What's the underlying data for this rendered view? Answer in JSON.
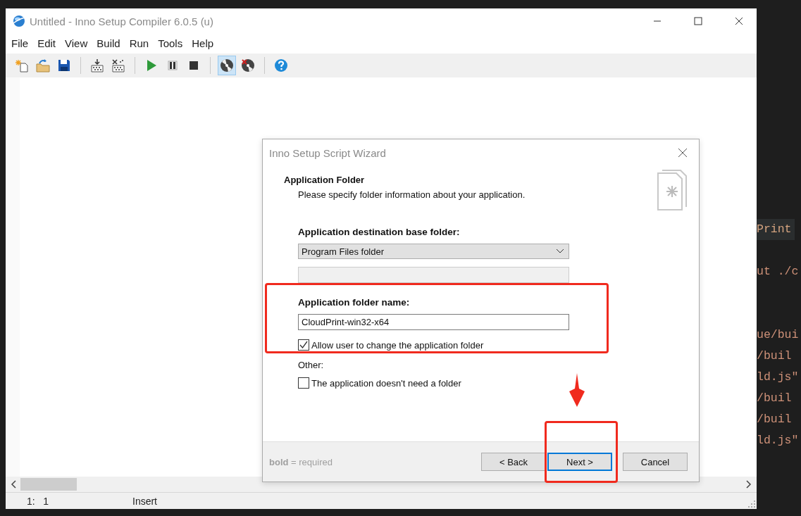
{
  "window": {
    "title": "Untitled - Inno Setup Compiler 6.0.5 (u)"
  },
  "menu": [
    "File",
    "Edit",
    "View",
    "Build",
    "Run",
    "Tools",
    "Help"
  ],
  "toolbar": [
    {
      "kind": "new",
      "selected": false
    },
    {
      "kind": "open",
      "selected": false
    },
    {
      "kind": "save",
      "selected": false
    },
    {
      "kind": "sep"
    },
    {
      "kind": "compile",
      "selected": false
    },
    {
      "kind": "clean",
      "selected": false
    },
    {
      "kind": "sep"
    },
    {
      "kind": "run",
      "selected": false
    },
    {
      "kind": "pause",
      "selected": false
    },
    {
      "kind": "stop",
      "selected": false
    },
    {
      "kind": "sep"
    },
    {
      "kind": "disc",
      "selected": true
    },
    {
      "kind": "disc-x",
      "selected": false
    },
    {
      "kind": "sep"
    },
    {
      "kind": "help",
      "selected": false
    }
  ],
  "status_bar": {
    "position": "1:   1",
    "mode": "Insert"
  },
  "background_code": [
    [
      "Print"
    ],
    [
      "ut ./c"
    ],
    [
      "ue/bui",
      "/buil",
      "ld.js\"",
      "/buil",
      "/buil",
      "ld.js\""
    ]
  ],
  "dialog": {
    "title": "Inno Setup Script Wizard",
    "heading": "Application Folder",
    "subheading": "Please specify folder information about your application.",
    "base_folder_label": "Application destination base folder:",
    "base_folder_value": "Program Files folder",
    "custom_folder_field": {
      "disabled": true
    },
    "folder_name_label": "Application folder name:",
    "folder_name_value": "CloudPrint-win32-x64",
    "checkboxes": [
      {
        "label": "Allow user to change the application folder",
        "checked": true
      }
    ],
    "other_label": "Other:",
    "other_checkboxes": [
      {
        "label": "The application doesn't need a folder",
        "checked": false
      }
    ],
    "legend": "**bold** = required",
    "buttons": [
      {
        "label": "< Back",
        "selected": false
      },
      {
        "label": "Next >",
        "selected": true
      },
      {
        "label": "Cancel",
        "selected": false
      }
    ]
  }
}
